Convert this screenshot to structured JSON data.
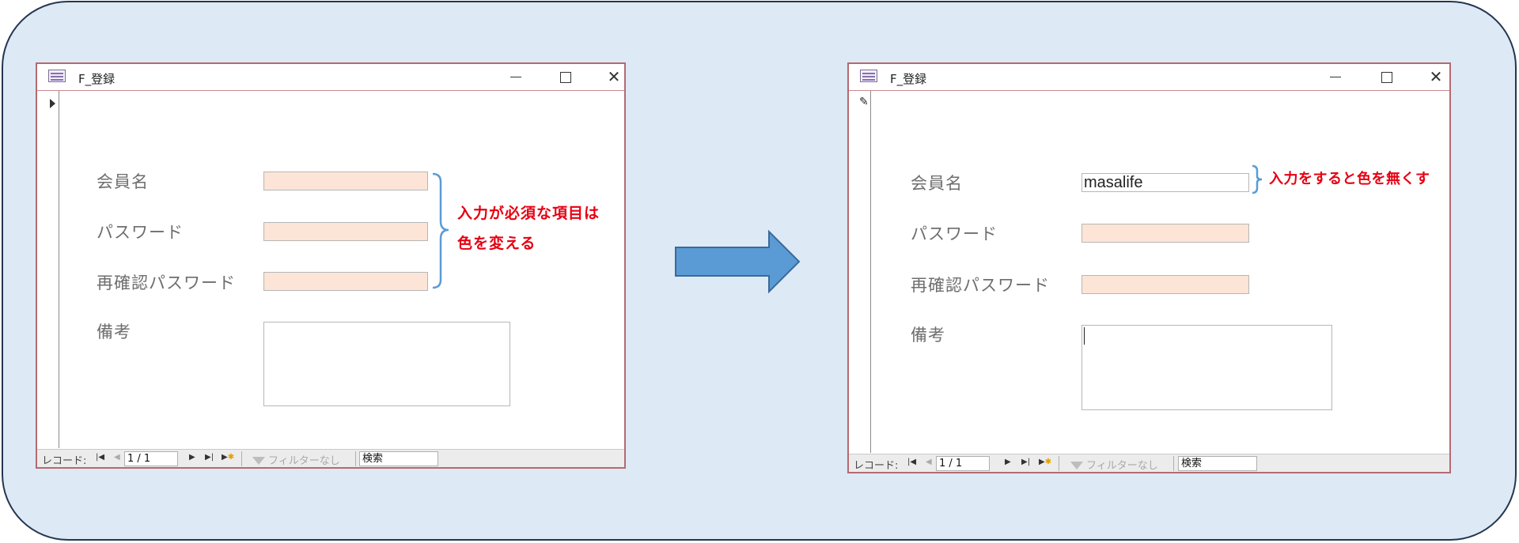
{
  "colors": {
    "panel_bg": "#dde9f5",
    "required_field": "#fce4d6",
    "annotation": "#e60012",
    "brace": "#5b9bd5",
    "arrow": "#5b9bd5"
  },
  "before": {
    "window": {
      "title": "F_登録",
      "minimize": "—",
      "maximize": "□",
      "close": "✕"
    },
    "labels": {
      "member_name": "会員名",
      "password": "パスワード",
      "confirm_password": "再確認パスワード",
      "notes": "備考"
    },
    "values": {
      "member_name": "",
      "password": "",
      "confirm_password": "",
      "notes": ""
    },
    "annotation": {
      "line1": "入力が必須な項目は",
      "line2": "色を変える"
    },
    "navbar": {
      "record_label": "レコード:",
      "position": "1 / 1",
      "filter": "フィルターなし",
      "search": "検索"
    }
  },
  "after": {
    "window": {
      "title": "F_登録",
      "minimize": "—",
      "maximize": "□",
      "close": "✕"
    },
    "labels": {
      "member_name": "会員名",
      "password": "パスワード",
      "confirm_password": "再確認パスワード",
      "notes": "備考"
    },
    "values": {
      "member_name": "masalife",
      "password": "",
      "confirm_password": "",
      "notes": ""
    },
    "annotation": {
      "line1": "入力をすると色を無くす"
    },
    "navbar": {
      "record_label": "レコード:",
      "position": "1 / 1",
      "filter": "フィルターなし",
      "search": "検索"
    }
  },
  "icons": {
    "record_selector": "record-selector-arrow-icon",
    "edit": "pencil-icon",
    "next_arrow": "right-arrow-icon",
    "filter": "funnel-icon"
  }
}
